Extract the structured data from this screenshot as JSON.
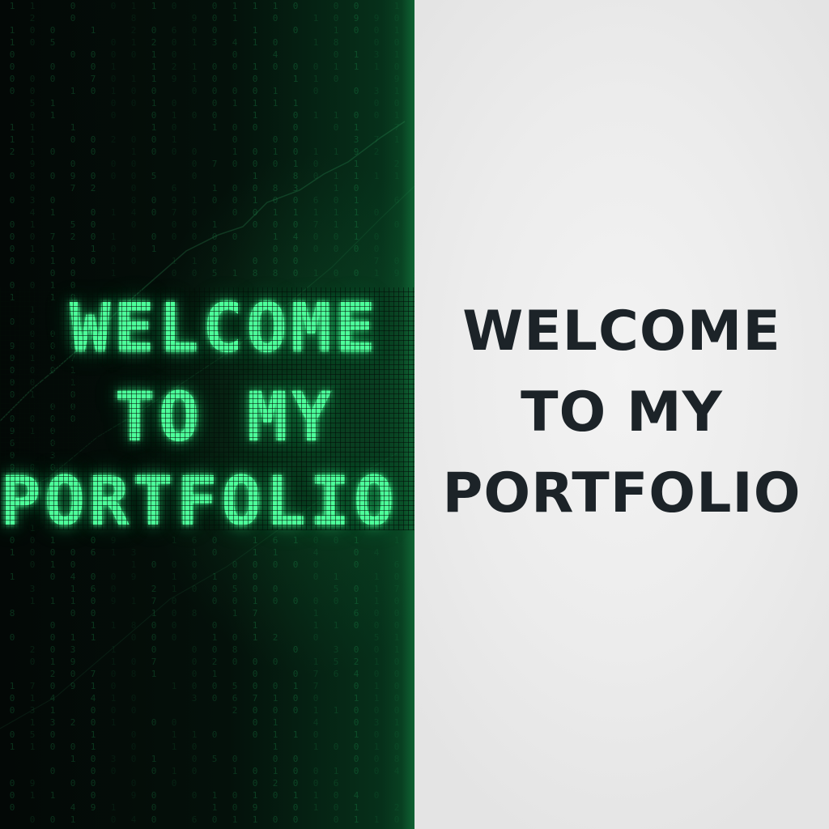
{
  "left_panel": {
    "theme": "matrix",
    "accent_color": "#4dff9a",
    "background_color": "#030806",
    "title_lines": [
      "WELCOME",
      "TO MY",
      "PORTFOLIO"
    ]
  },
  "right_panel": {
    "theme": "minimal",
    "text_color": "#1c2328",
    "background_color": "#efefef",
    "title_lines": [
      "WELCOME",
      "TO MY",
      "PORTFOLIO"
    ]
  }
}
